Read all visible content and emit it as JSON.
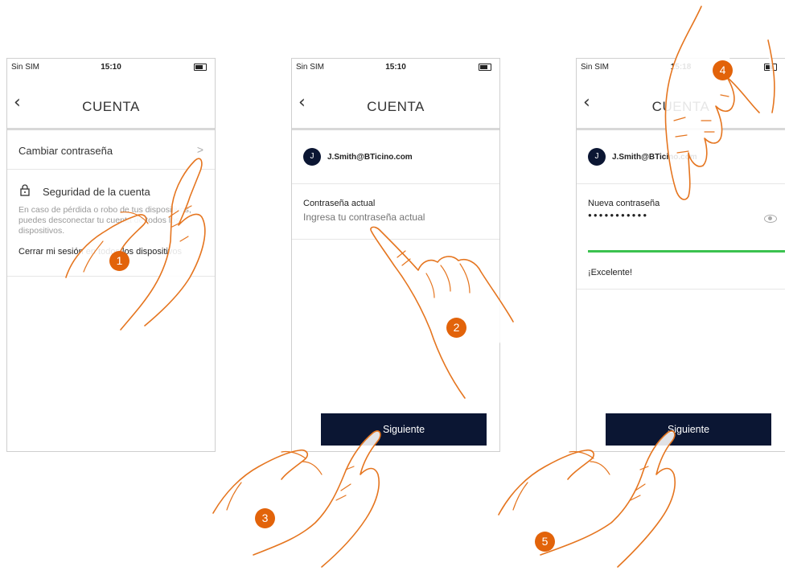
{
  "screens": [
    {
      "status": {
        "carrier": "Sin SIM",
        "time": "15:10"
      },
      "header": {
        "back": "‹",
        "title": "CUENTA"
      },
      "change_password": {
        "label": "Cambiar contraseña",
        "chevron": ">"
      },
      "security": {
        "title": "Seguridad de la cuenta",
        "description": "En caso de pérdida o robo de tus dispositivos, puedes desconectar tu cuenta de todos los dispositivos.",
        "logout_link": "Cerrar mi sesión en todos los dispositivos"
      }
    },
    {
      "status": {
        "carrier": "Sin SIM",
        "time": "15:10"
      },
      "header": {
        "back": "‹",
        "title": "CUENTA"
      },
      "user": {
        "initial": "J",
        "email": "J.Smith@BTicino.com"
      },
      "field": {
        "label": "Contraseña actual",
        "placeholder": "Ingresa tu contraseña actual"
      },
      "next_button": "Siguiente"
    },
    {
      "status": {
        "carrier": "Sin SIM",
        "time": "15:18"
      },
      "header": {
        "back": "‹",
        "title": "CUENTA"
      },
      "user": {
        "initial": "J",
        "email": "J.Smith@BTicino.com"
      },
      "field": {
        "label": "Nueva contraseña",
        "value": "●●●●●●●●●●●"
      },
      "strength": {
        "label": "¡Excelente!",
        "color": "#3bc24f",
        "level": 1.0
      },
      "next_button": "Siguiente"
    }
  ],
  "steps": [
    "1",
    "2",
    "3",
    "4",
    "5"
  ],
  "colors": {
    "accent": "#e2630a",
    "button": "#0b1633",
    "hand_outline": "#e5751f"
  }
}
